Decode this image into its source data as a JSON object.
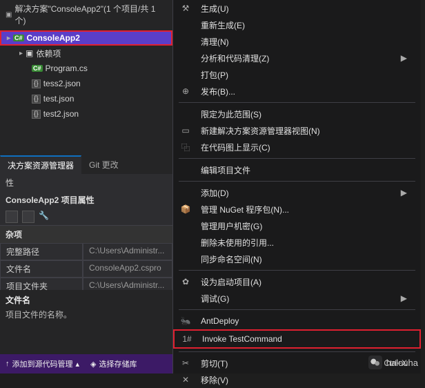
{
  "solution_header": "解决方案\"ConsoleApp2\"(1 个项目/共 1 个)",
  "project_name": "ConsoleApp2",
  "tree": {
    "deps": "依赖项",
    "program": "Program.cs",
    "tess2": "tess2.json",
    "test": "test.json",
    "test2": "test2.json"
  },
  "tabs": {
    "explorer": "决方案资源管理器",
    "git": "Git 更改"
  },
  "props": {
    "title": "性",
    "subtitle": "ConsoleApp2 项目属性",
    "category": "杂项",
    "rows": [
      {
        "name": "完整路径",
        "value": "C:\\Users\\Administr..."
      },
      {
        "name": "文件名",
        "value": "ConsoleApp2.cspro"
      },
      {
        "name": "项目文件夹",
        "value": "C:\\Users\\Administr..."
      }
    ],
    "desc_title": "文件名",
    "desc_body": "项目文件的名称。"
  },
  "menu": {
    "build": "生成(U)",
    "rebuild": "重新生成(E)",
    "clean": "清理(N)",
    "analyze": "分析和代码清理(Z)",
    "pack": "打包(P)",
    "publish": "发布(B)...",
    "scope": "限定为此范围(S)",
    "newview": "新建解决方案资源管理器视图(N)",
    "codemap": "在代码图上显示(C)",
    "editproj": "编辑项目文件",
    "add": "添加(D)",
    "nuget": "管理 NuGet 程序包(N)...",
    "secrets": "管理用户机密(G)",
    "removerefs": "删除未使用的引用...",
    "syncns": "同步命名空间(N)",
    "startup": "设为启动项目(A)",
    "debug": "调试(G)",
    "antdeploy": "AntDeploy",
    "testcmd": "Invoke TestCommand",
    "cut": "剪切(T)",
    "cut_shortcut": "Ctrl+X",
    "remove": "移除(V)"
  },
  "status": {
    "source_ctrl": "添加到源代码管理",
    "select_repo": "选择存储库"
  },
  "watermark": "halouha"
}
